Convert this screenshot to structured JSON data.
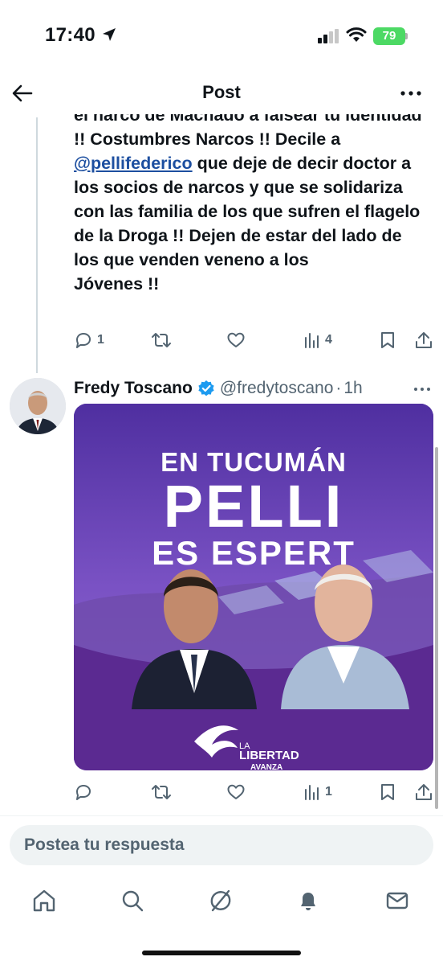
{
  "status_bar": {
    "time": "17:40",
    "battery": "79"
  },
  "header": {
    "title": "Post"
  },
  "tweet1": {
    "text_before_mention": "el narco de Machado a falsear tu identidad !! Costumbres Narcos !! Decile a ",
    "mention": "@pellifederico",
    "text_after_mention": " que deje de decir doctor a los socios de narcos y que se solidariza con las familia de los que sufren el flagelo de la Droga !! Dejen de estar del lado de los que venden veneno a los",
    "text_last_line": "Jóvenes !!",
    "actions": {
      "replies": "1",
      "reposts": "",
      "likes": "",
      "views": "4"
    }
  },
  "tweet2": {
    "author_name": "Fredy Toscano",
    "handle": "@fredytoscano",
    "separator": "·",
    "time": "1h",
    "media": {
      "line1": "EN TUCUMÁN",
      "line2": "PELLI",
      "line3": "ES ESPERT",
      "logo_small": "LA",
      "logo_main": "LIBERTAD",
      "logo_sub": "AVANZA"
    },
    "actions": {
      "replies": "",
      "reposts": "",
      "likes": "",
      "views": "1"
    }
  },
  "reply": {
    "placeholder": "Postea tu respuesta"
  },
  "colors": {
    "accent": "#1d9bf0",
    "muted": "#536471",
    "media_purple": "#6c3fb4",
    "battery_green": "#4cd964"
  },
  "icons": [
    "location-arrow-icon",
    "signal-icon",
    "wifi-icon",
    "back-arrow-icon",
    "more-icon",
    "reply-icon",
    "repost-icon",
    "like-icon",
    "views-icon",
    "bookmark-icon",
    "share-icon",
    "verified-icon",
    "home-icon",
    "search-icon",
    "grok-icon",
    "notifications-icon",
    "messages-icon"
  ]
}
